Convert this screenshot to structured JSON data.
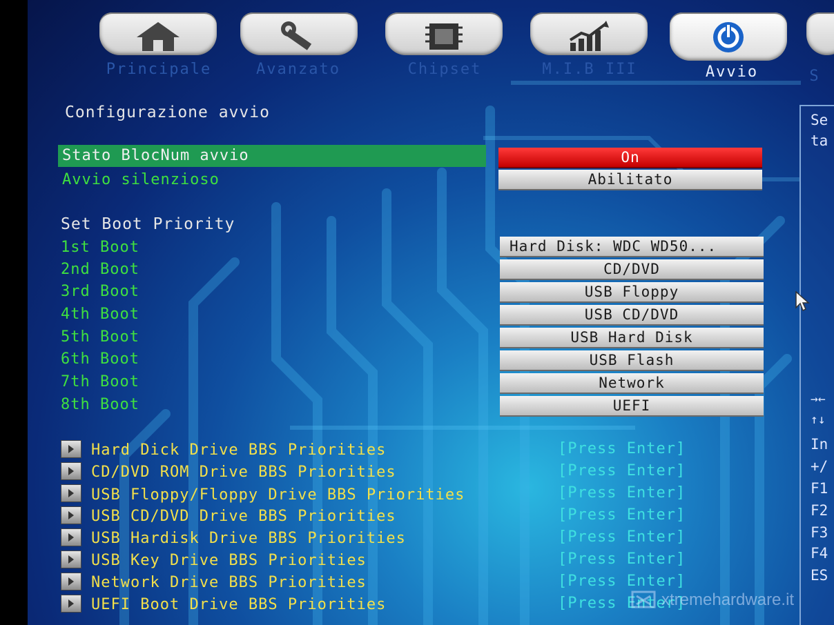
{
  "tabs": [
    {
      "label": "Principale",
      "icon": "home-icon",
      "active": false
    },
    {
      "label": "Avanzato",
      "icon": "wrench-icon",
      "active": false
    },
    {
      "label": "Chipset",
      "icon": "chip-icon",
      "active": false
    },
    {
      "label": "M.I.B III",
      "icon": "chart-icon",
      "active": false
    },
    {
      "label": "Avvio",
      "icon": "power-icon",
      "active": true
    },
    {
      "label": "S",
      "icon": "",
      "active": false
    }
  ],
  "boot_config": {
    "title": "Configurazione avvio",
    "numlock_label": "Stato BlocNum avvio",
    "numlock_value": "On",
    "quiet_label": "Avvio silenzioso",
    "quiet_value": "Abilitato"
  },
  "boot_priority": {
    "title": "Set Boot Priority",
    "items": [
      {
        "label": "1st Boot",
        "value": "Hard Disk: WDC WD50..."
      },
      {
        "label": "2nd Boot",
        "value": "CD/DVD"
      },
      {
        "label": "3rd Boot",
        "value": "USB Floppy"
      },
      {
        "label": "4th Boot",
        "value": "USB CD/DVD"
      },
      {
        "label": "5th Boot",
        "value": "USB Hard Disk"
      },
      {
        "label": "6th Boot",
        "value": "USB Flash"
      },
      {
        "label": "7th Boot",
        "value": "Network"
      },
      {
        "label": "8th Boot",
        "value": "UEFI"
      }
    ]
  },
  "bbs": {
    "items": [
      {
        "label": "Hard Dick Drive BBS Priorities",
        "action": "[Press Enter]"
      },
      {
        "label": "CD/DVD ROM Drive BBS Priorities",
        "action": "[Press Enter]"
      },
      {
        "label": "USB Floppy/Floppy Drive BBS Priorities",
        "action": "[Press Enter]"
      },
      {
        "label": "USB CD/DVD Drive BBS Priorities",
        "action": "[Press Enter]"
      },
      {
        "label": "USB Hardisk Drive BBS Priorities",
        "action": "[Press Enter]"
      },
      {
        "label": "USB Key Drive BBS Priorities",
        "action": "[Press Enter]"
      },
      {
        "label": "Network Drive BBS Priorities",
        "action": "[Press Enter]"
      },
      {
        "label": "UEFI Boot Drive BBS Priorities",
        "action": "[Press Enter]"
      }
    ]
  },
  "help_panel": {
    "top_lines": [
      "Se",
      "ta"
    ],
    "keys": [
      "→←",
      "↑↓",
      "In",
      "+/",
      "F1",
      "F2",
      "F3",
      "F4",
      "ES"
    ]
  },
  "watermark": "xtremehardware.it",
  "colors": {
    "highlight": "#1f9a52",
    "on_value": "#d40000",
    "item_label": "#3fe03f",
    "submenu_label": "#f3e04a",
    "press_enter": "#3fe0e0"
  }
}
